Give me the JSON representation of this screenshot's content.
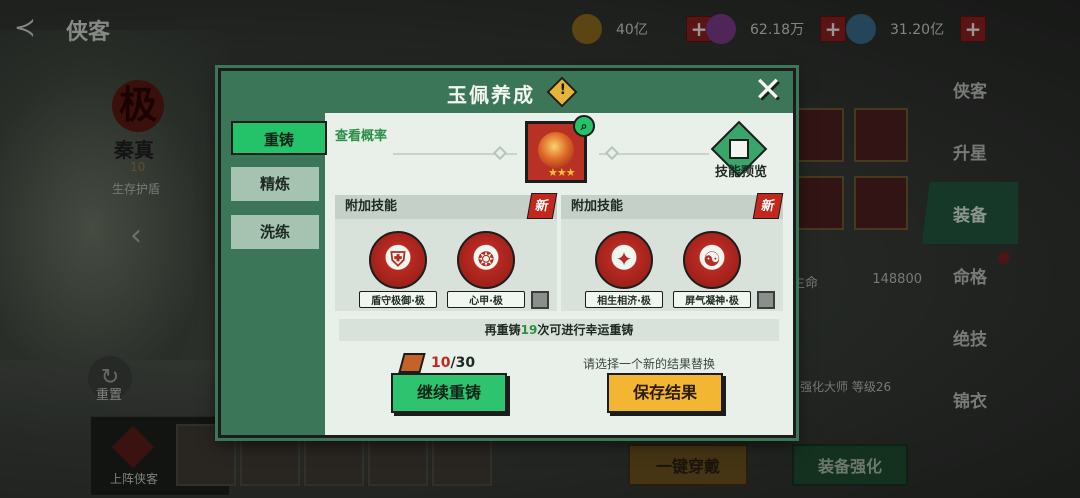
{
  "top": {
    "title": "侠客",
    "resources": [
      {
        "icon": "coin-icon",
        "value": "40亿"
      },
      {
        "icon": "gem-icon",
        "value": "62.18万"
      },
      {
        "icon": "orb-icon",
        "value": "31.20亿"
      }
    ],
    "plus": "+"
  },
  "hero": {
    "grade": "极",
    "name": "秦真",
    "level": "10",
    "skill": "生存护盾"
  },
  "left": {
    "reset": "重置",
    "lineup": "上阵侠客"
  },
  "right_tabs": [
    {
      "label": "侠客"
    },
    {
      "label": "升星"
    },
    {
      "label": "装备",
      "active": true
    },
    {
      "label": "命格"
    },
    {
      "label": "绝技"
    },
    {
      "label": "锦衣"
    }
  ],
  "stats": {
    "life_label": "生命",
    "life_value": "148800",
    "master": "强化大师 等级26"
  },
  "bottom": {
    "one_key": "一键穿戴",
    "enhance": "装备强化"
  },
  "modal": {
    "title": "玉佩养成",
    "warn": "!",
    "close": "✕",
    "tabs": [
      {
        "label": "重铸",
        "active": true
      },
      {
        "label": "精炼"
      },
      {
        "label": "洗练"
      }
    ],
    "view_rate": "查看概率",
    "item_stars": "★★★",
    "skill_preview": "技能预览",
    "panels": [
      {
        "header": "附加技能",
        "badge": "新",
        "skills": [
          {
            "glyph": "⛨",
            "name": "盾守极御·极"
          },
          {
            "glyph": "❂",
            "name": "心甲·极"
          }
        ]
      },
      {
        "header": "附加技能",
        "badge": "新",
        "skills": [
          {
            "glyph": "✦",
            "name": "相生相济·极"
          },
          {
            "glyph": "☯",
            "name": "屏气凝神·极"
          }
        ]
      }
    ],
    "hint_before": "再重铸",
    "hint_count": "19",
    "hint_after": "次可进行幸运重铸",
    "cost_current": "10",
    "cost_total": "/30",
    "choose_hint": "请选择一个新的结果替换",
    "btn_continue": "继续重铸",
    "btn_save": "保存结果"
  }
}
